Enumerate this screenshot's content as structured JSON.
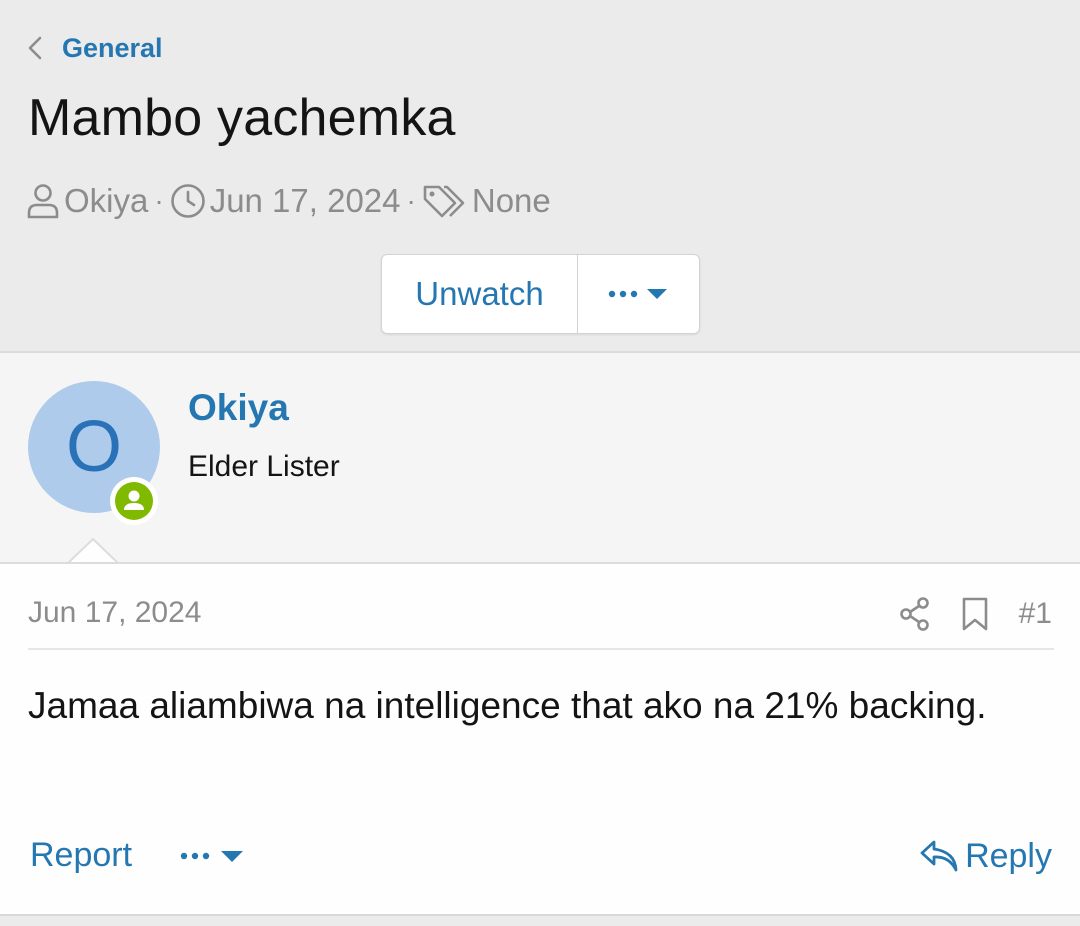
{
  "breadcrumb": {
    "label": "General"
  },
  "thread": {
    "title": "Mambo yachemka",
    "author": "Okiya",
    "date": "Jun 17, 2024",
    "tags": "None",
    "separator": "·"
  },
  "buttons": {
    "unwatch": "Unwatch"
  },
  "user": {
    "avatar_letter": "O",
    "name": "Okiya",
    "title": "Elder Lister",
    "avatar_color": "#aecbec",
    "online_color": "#7fb900"
  },
  "post": {
    "date": "Jun 17, 2024",
    "number": "#1",
    "body": "Jamaa aliambiwa na intelligence that ako na 21% backing.",
    "report_label": "Report",
    "reply_label": "Reply"
  },
  "icons": {
    "back": "chevron-left-icon",
    "user": "user-icon",
    "clock": "clock-icon",
    "tag": "tag-icon",
    "share": "share-icon",
    "bookmark": "bookmark-icon",
    "reply": "reply-icon"
  },
  "colors": {
    "link": "#2577b1",
    "muted": "#8c8c8c",
    "text": "#141414"
  }
}
